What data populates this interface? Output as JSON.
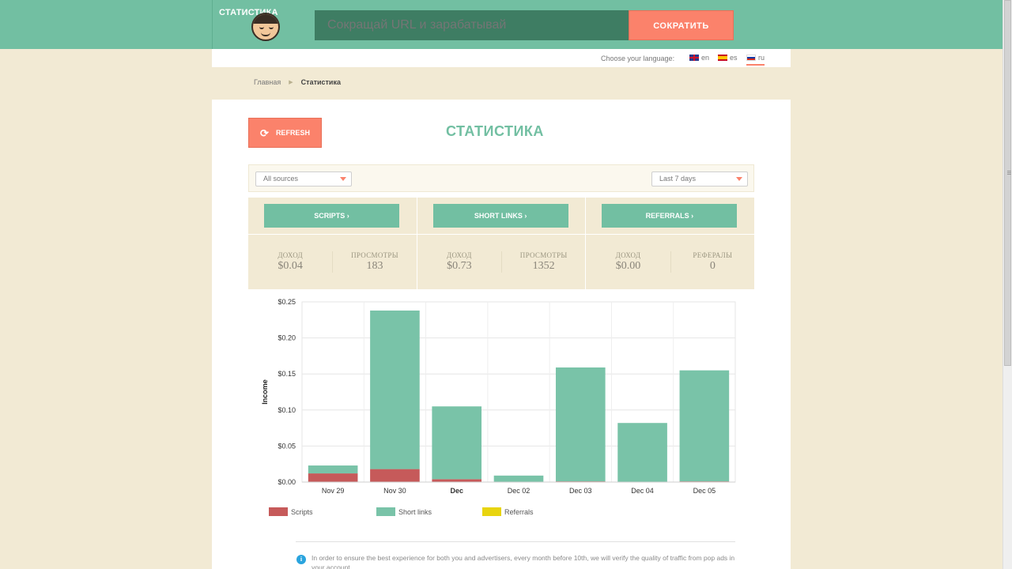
{
  "header": {
    "logo_text": "СТАТИСТИКА",
    "search_placeholder": "Сокращай URL и зарабатывай",
    "shorten_label": "СОКРАТИТЬ"
  },
  "language": {
    "label": "Choose your language:",
    "options": [
      {
        "code": "en",
        "flag": "uk"
      },
      {
        "code": "es",
        "flag": "spain"
      },
      {
        "code": "ru",
        "flag": "russia",
        "active": true
      }
    ]
  },
  "breadcrumb": {
    "home": "Главная",
    "current": "Статистика"
  },
  "main": {
    "refresh_label": "REFRESH",
    "title": "СТАТИСТИКА",
    "filters": {
      "source": "All sources",
      "period": "Last 7 days"
    },
    "sections": [
      {
        "button": "SCRIPTS ›",
        "left_label": "ДОХОД",
        "left_value": "$0.04",
        "right_label": "ПРОСМОТРЫ",
        "right_value": "183"
      },
      {
        "button": "SHORT LINKS ›",
        "left_label": "ДОХОД",
        "left_value": "$0.73",
        "right_label": "ПРОСМОТРЫ",
        "right_value": "1352"
      },
      {
        "button": "REFERRALS ›",
        "left_label": "ДОХОД",
        "left_value": "$0.00",
        "right_label": "РЕФЕРАЛЫ",
        "right_value": "0"
      }
    ],
    "notice": "In order to ensure the best experience for both you and advertisers, every month before 10th, we will verify the quality of traffic from pop ads in your account."
  },
  "colors": {
    "accent_green": "#72bfa2",
    "accent_orange": "#fb826b",
    "scripts": "#c65a5a",
    "short_links": "#79c3a8",
    "referrals": "#e8d40f"
  },
  "chart_data": {
    "type": "bar",
    "stacked": true,
    "categories": [
      "Nov 29",
      "Nov 30",
      "Dec",
      "Dec 02",
      "Dec 03",
      "Dec 04",
      "Dec 05"
    ],
    "bold_categories": [
      "Dec"
    ],
    "series": [
      {
        "name": "Scripts",
        "color": "#c65a5a",
        "values": [
          0.012,
          0.018,
          0.004,
          0.0,
          0.001,
          0.0,
          0.001
        ]
      },
      {
        "name": "Short links",
        "color": "#79c3a8",
        "values": [
          0.011,
          0.22,
          0.101,
          0.009,
          0.158,
          0.082,
          0.154
        ]
      },
      {
        "name": "Referrals",
        "color": "#e8d40f",
        "values": [
          0,
          0,
          0,
          0,
          0,
          0,
          0
        ]
      }
    ],
    "ylabel": "Income",
    "ylim": [
      0,
      0.25
    ],
    "yticks": [
      "$0.00",
      "$0.05",
      "$0.10",
      "$0.15",
      "$0.20",
      "$0.25"
    ],
    "grid": true,
    "legend": "bottom"
  }
}
